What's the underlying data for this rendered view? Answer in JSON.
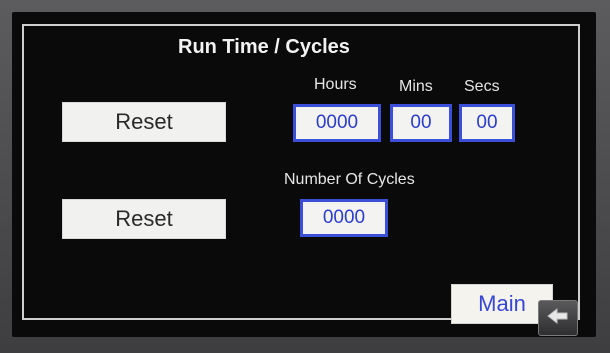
{
  "title": "Run Time / Cycles",
  "labels": {
    "hours": "Hours",
    "mins": "Mins",
    "secs": "Secs",
    "number_of_cycles": "Number Of Cycles"
  },
  "run_time": {
    "reset_label": "Reset",
    "hours": "0000",
    "mins": "00",
    "secs": "00"
  },
  "cycles": {
    "reset_label": "Reset",
    "count": "0000"
  },
  "nav": {
    "main_label": "Main",
    "back_icon": "back-arrow-icon"
  },
  "colors": {
    "value_border": "#3b4fd8",
    "value_text": "#2b3dc9",
    "screen_bg": "#0a0a0a"
  }
}
